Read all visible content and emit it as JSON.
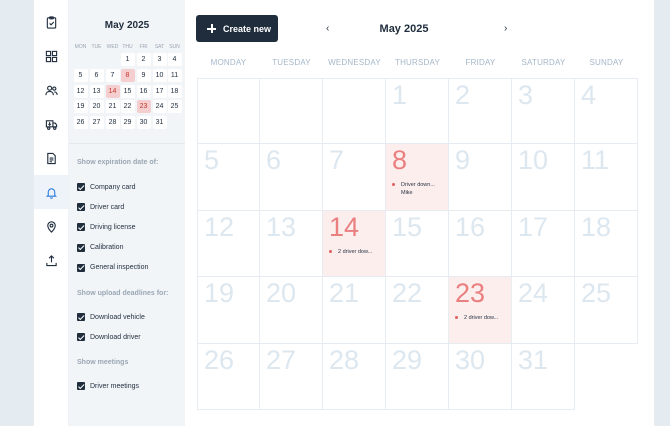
{
  "mini_calendar": {
    "title": "May 2025",
    "weekdays": [
      "MON",
      "TUE",
      "WED",
      "THU",
      "FRI",
      "SAT",
      "SUN"
    ],
    "weeks": [
      [
        "",
        "",
        "",
        "1",
        "2",
        "3",
        "4"
      ],
      [
        "5",
        "6",
        "7",
        "8",
        "9",
        "10",
        "11"
      ],
      [
        "12",
        "13",
        "14",
        "15",
        "16",
        "17",
        "18"
      ],
      [
        "19",
        "20",
        "21",
        "22",
        "23",
        "24",
        "25"
      ],
      [
        "26",
        "27",
        "28",
        "29",
        "30",
        "31",
        ""
      ]
    ],
    "highlighted": [
      "8",
      "14",
      "23"
    ]
  },
  "filters": {
    "expiration_title": "Show expiration date of:",
    "expiration_items": [
      "Company card",
      "Driver card",
      "Driving license",
      "Calibration",
      "General inspection"
    ],
    "upload_title": "Show upload deadlines for:",
    "upload_items": [
      "Download vehicle",
      "Download driver"
    ],
    "meetings_title": "Show meetings",
    "meetings_items": [
      "Driver meetings"
    ]
  },
  "toolbar": {
    "create_label": "Create new",
    "prev_arrow": "‹",
    "next_arrow": "›",
    "month_title": "May 2025"
  },
  "calendar": {
    "weekdays": [
      "MONDAY",
      "TUESDAY",
      "WEDNESDAY",
      "THURSDAY",
      "FRIDAY",
      "SATURDAY",
      "SUNDAY"
    ],
    "weeks": [
      [
        "",
        "",
        "",
        "1",
        "2",
        "3",
        "4"
      ],
      [
        "5",
        "6",
        "7",
        "8",
        "9",
        "10",
        "11"
      ],
      [
        "12",
        "13",
        "14",
        "15",
        "16",
        "17",
        "18"
      ],
      [
        "19",
        "20",
        "21",
        "22",
        "23",
        "24",
        "25"
      ],
      [
        "26",
        "27",
        "28",
        "29",
        "30",
        "31",
        ""
      ]
    ],
    "events": {
      "8": [
        "Driver down...",
        "Mike"
      ],
      "14": [
        "2 driver dow..."
      ],
      "23": [
        "2 driver dow..."
      ]
    }
  },
  "rail_icons": [
    "clipboard-check-icon",
    "dashboard-grid-icon",
    "users-icon",
    "truck-download-icon",
    "document-icon",
    "bell-icon",
    "location-pin-icon",
    "upload-icon"
  ],
  "colors": {
    "primary": "#1f2d3d",
    "highlight_bg": "#fdeeee",
    "highlight_text": "#e97f7f",
    "event_dot": "#e26060"
  }
}
